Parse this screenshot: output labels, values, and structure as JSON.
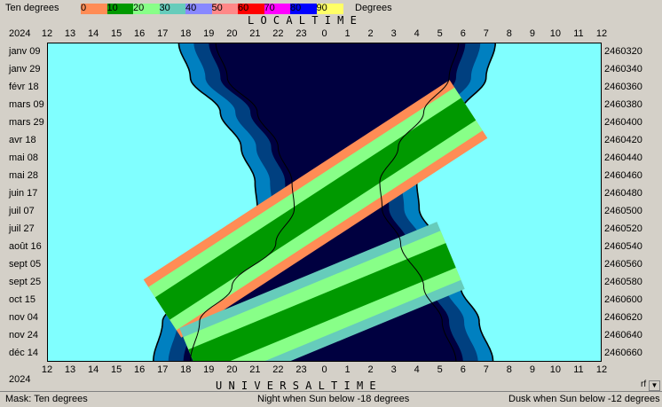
{
  "legend": {
    "title": "Ten degrees",
    "unit": "Degrees",
    "items": [
      {
        "label": "0",
        "color": "#ff8c55"
      },
      {
        "label": "10",
        "color": "#009900"
      },
      {
        "label": "20",
        "color": "#88ff88"
      },
      {
        "label": "30",
        "color": "#66ccbb"
      },
      {
        "label": "40",
        "color": "#8888ff"
      },
      {
        "label": "50",
        "color": "#ff8888"
      },
      {
        "label": "60",
        "color": "#ff0000"
      },
      {
        "label": "70",
        "color": "#ff00ff"
      },
      {
        "label": "80",
        "color": "#0000ff"
      },
      {
        "label": "90",
        "color": "#ffff66"
      }
    ]
  },
  "top_axis_title": "L O C A L   T I M E",
  "bottom_axis_title": "U N I V E R S A L   T I M E",
  "year_top": "2024",
  "year_bottom": "2024",
  "rf_label": "rf",
  "scroll_icon": "down-arrow-icon",
  "status": {
    "left": "Mask:  Ten degrees",
    "center": "Night when Sun below -18 degrees",
    "right": "Dusk when Sun below -12 degrees"
  },
  "chart_data": {
    "type": "area",
    "x_ticks": [
      "12",
      "13",
      "14",
      "15",
      "16",
      "17",
      "18",
      "19",
      "20",
      "21",
      "22",
      "23",
      "0",
      "1",
      "2",
      "3",
      "4",
      "5",
      "6",
      "7",
      "8",
      "9",
      "10",
      "11",
      "12"
    ],
    "y_ticks_left": [
      "janv 09",
      "janv 29",
      "févr 18",
      "mars 09",
      "mars 29",
      "avr 18",
      "mai 08",
      "mai 28",
      "juin 17",
      "juil 07",
      "juil 27",
      "août 16",
      "sept 05",
      "sept 25",
      "oct 15",
      "nov 04",
      "nov 24",
      "déc 14"
    ],
    "y_ticks_right": [
      "2460320",
      "2460340",
      "2460360",
      "2460380",
      "2460400",
      "2460420",
      "2460440",
      "2460460",
      "2460480",
      "2460500",
      "2460520",
      "2460540",
      "2460560",
      "2460580",
      "2460600",
      "2460620",
      "2460640",
      "2460660"
    ],
    "x_range_hours": [
      12,
      36
    ],
    "colors": {
      "day": "#80ffff",
      "civil_twilight": "#0080c0",
      "nautical_twilight": "#004080",
      "night": "#000040",
      "dusk_line": "#000000"
    },
    "night_start_local_hours": [
      {
        "day": 0,
        "t": 19.0
      },
      {
        "day": 40,
        "t": 19.5
      },
      {
        "day": 80,
        "t": 20.8
      },
      {
        "day": 120,
        "t": 21.7
      },
      {
        "day": 160,
        "t": 22.3
      },
      {
        "day": 190,
        "t": 22.4
      },
      {
        "day": 230,
        "t": 21.6
      },
      {
        "day": 280,
        "t": 19.7
      },
      {
        "day": 320,
        "t": 18.3
      },
      {
        "day": 366,
        "t": 17.9
      }
    ],
    "night_end_local_hours": [
      {
        "day": 0,
        "t": 30.1
      },
      {
        "day": 40,
        "t": 29.7
      },
      {
        "day": 80,
        "t": 28.6
      },
      {
        "day": 120,
        "t": 27.5
      },
      {
        "day": 160,
        "t": 26.7
      },
      {
        "day": 190,
        "t": 26.8
      },
      {
        "day": 230,
        "t": 27.6
      },
      {
        "day": 280,
        "t": 28.6
      },
      {
        "day": 320,
        "t": 29.4
      },
      {
        "day": 366,
        "t": 30.0
      }
    ],
    "mask_bands": [
      "0",
      "10",
      "20",
      "30"
    ]
  }
}
